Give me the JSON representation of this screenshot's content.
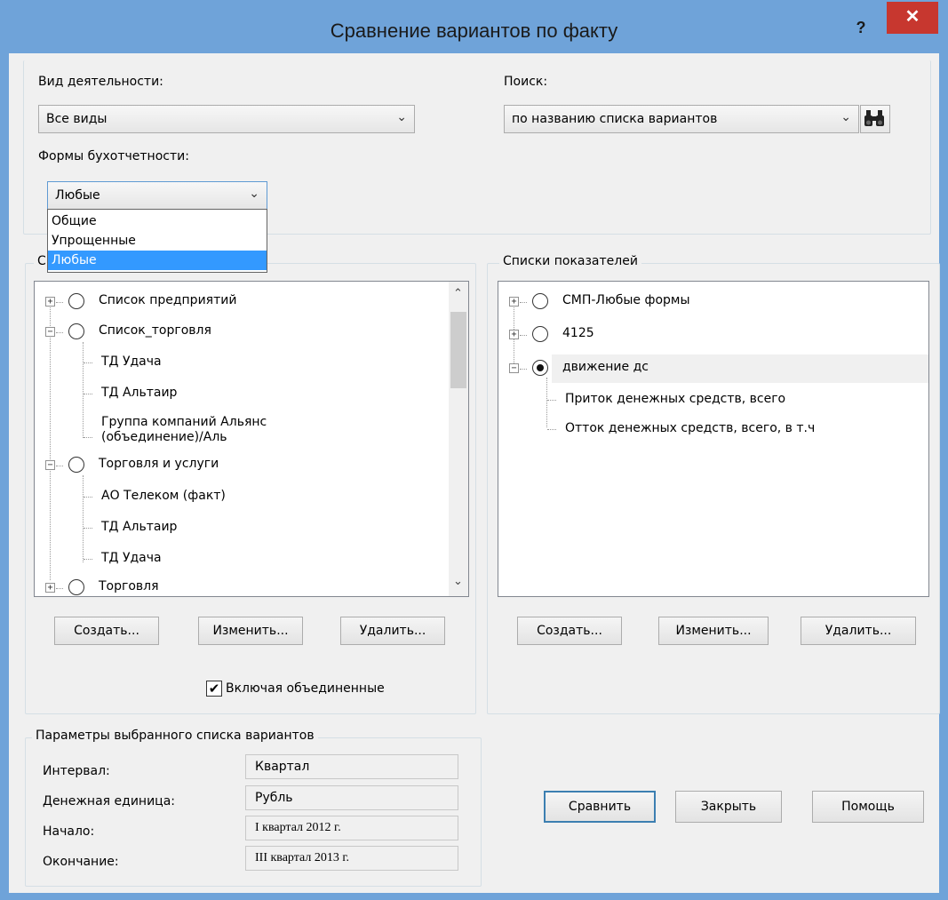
{
  "window": {
    "title": "Сравнение вариантов по факту",
    "help": "?",
    "close": "✕"
  },
  "activity": {
    "label": "Вид деятельности:",
    "value": "Все виды"
  },
  "search": {
    "label": "Поиск:",
    "value": "по названию списка вариантов",
    "button_icon": "binoculars-icon"
  },
  "forms": {
    "label": "Формы бухотчетности:",
    "value": "Любые",
    "options": [
      "Общие",
      "Упрощенные",
      "Любые"
    ],
    "selected_option": "Любые"
  },
  "variants": {
    "caption": "С",
    "tree": [
      {
        "label": "Список предприятий",
        "level": 0,
        "expander": "+"
      },
      {
        "label": "Список_торговля",
        "level": 0,
        "expander": "−"
      },
      {
        "label": "ТД Удача",
        "level": 1
      },
      {
        "label": "ТД Альтаир",
        "level": 1
      },
      {
        "label": "Группа компаний Альянс (объединение)/Аль",
        "level": 1
      },
      {
        "label": "Торговля и услуги",
        "level": 0,
        "expander": "−"
      },
      {
        "label": "АО Телеком (факт)",
        "level": 1
      },
      {
        "label": "ТД Альтаир",
        "level": 1
      },
      {
        "label": "ТД Удача",
        "level": 1
      },
      {
        "label": "Торговля",
        "level": 0,
        "expander": "+"
      }
    ],
    "buttons": {
      "create": "Создать...",
      "edit": "Изменить...",
      "delete": "Удалить..."
    },
    "include_merged": {
      "label": "Включая объединенные",
      "checked": true
    }
  },
  "indicators": {
    "caption": "Списки показателей",
    "tree": [
      {
        "label": "СМП-Любые формы",
        "level": 0,
        "expander": "+",
        "selected": false
      },
      {
        "label": "4125",
        "level": 0,
        "expander": "+",
        "selected": false
      },
      {
        "label": "движение дс",
        "level": 0,
        "expander": "−",
        "selected": true
      },
      {
        "label": "Приток денежных средств, всего",
        "level": 1
      },
      {
        "label": "Отток денежных средств, всего, в т.ч",
        "level": 1
      }
    ],
    "buttons": {
      "create": "Создать...",
      "edit": "Изменить...",
      "delete": "Удалить..."
    }
  },
  "params": {
    "caption": "Параметры выбранного списка вариантов",
    "interval_label": "Интервал:",
    "interval_value": "Квартал",
    "currency_label": "Денежная единица:",
    "currency_value": "Рубль",
    "start_label": "Начало:",
    "start_value": "I квартал 2012 г.",
    "end_label": "Окончание:",
    "end_value": "III квартал 2013 г."
  },
  "actions": {
    "compare": "Сравнить",
    "close": "Закрыть",
    "help": "Помощь"
  }
}
